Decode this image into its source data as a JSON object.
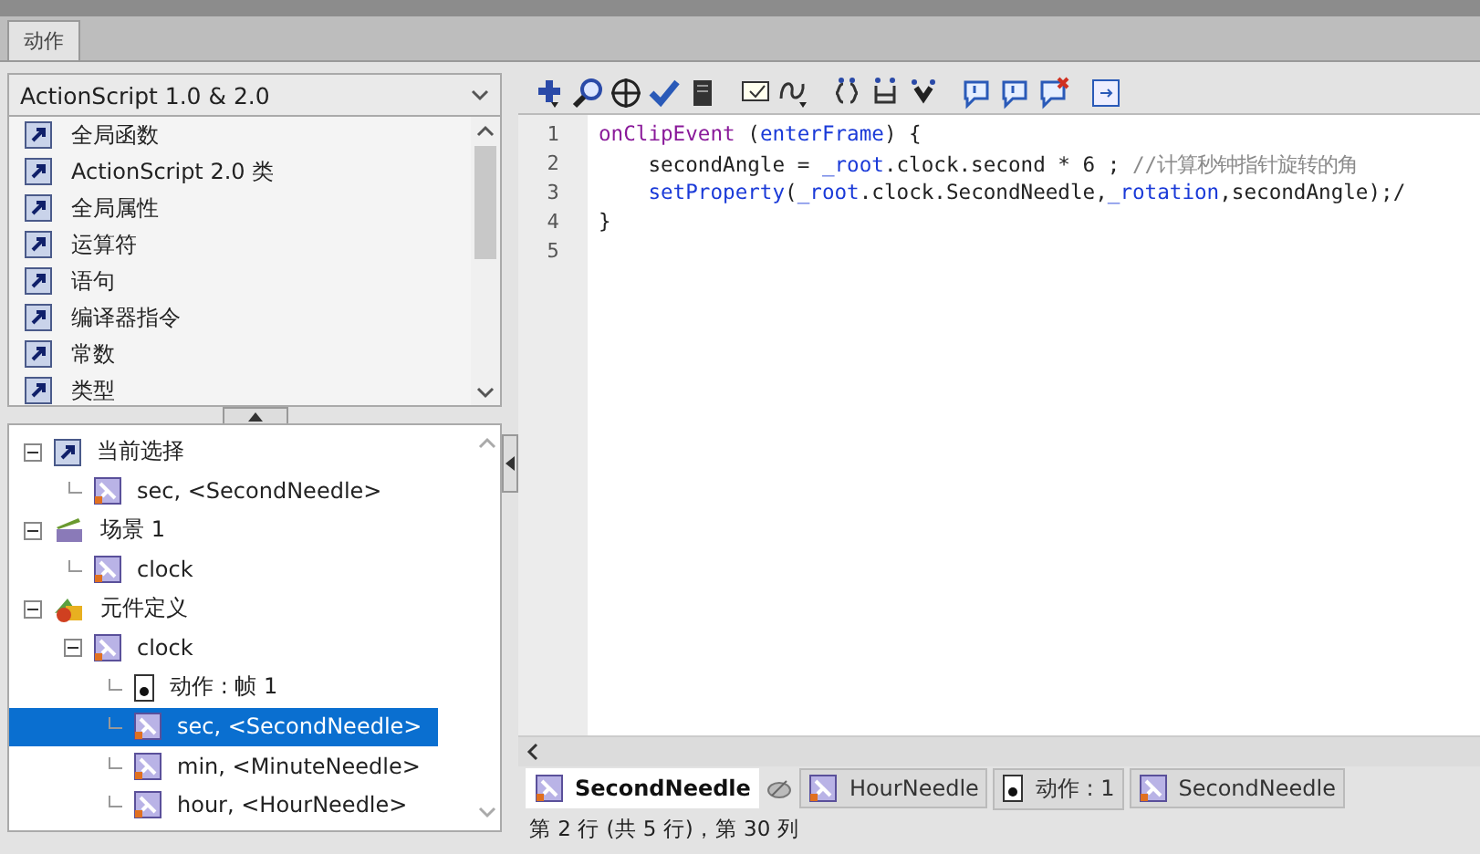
{
  "panel_tab": {
    "label": "动作",
    "selected": true
  },
  "version_dropdown": {
    "value": "ActionScript 1.0 & 2.0"
  },
  "categories": [
    {
      "label": "全局函数"
    },
    {
      "label": "ActionScript 2.0 类"
    },
    {
      "label": "全局属性"
    },
    {
      "label": "运算符"
    },
    {
      "label": "语句"
    },
    {
      "label": "编译器指令"
    },
    {
      "label": "常数"
    },
    {
      "label": "类型"
    }
  ],
  "tree": [
    {
      "label": "当前选择",
      "kind": "book",
      "expanded": true,
      "selected": false,
      "children": [
        {
          "label": "sec, <SecondNeedle>",
          "kind": "clip",
          "selected": false
        }
      ]
    },
    {
      "label": "场景 1",
      "kind": "scene",
      "expanded": true,
      "selected": false,
      "children": [
        {
          "label": "clock",
          "kind": "clip",
          "selected": false
        }
      ]
    },
    {
      "label": "元件定义",
      "kind": "library",
      "expanded": true,
      "selected": false,
      "children": [
        {
          "label": "clock",
          "kind": "clip",
          "expanded": true,
          "selected": false,
          "children": [
            {
              "label": "动作 : 帧 1",
              "kind": "frame",
              "selected": false
            },
            {
              "label": "sec, <SecondNeedle>",
              "kind": "clip",
              "selected": true
            },
            {
              "label": "min, <MinuteNeedle>",
              "kind": "clip",
              "selected": false
            },
            {
              "label": "hour, <HourNeedle>",
              "kind": "clip",
              "selected": false
            }
          ]
        }
      ]
    }
  ],
  "code_lines": [
    {
      "number": "1",
      "tokens": [
        {
          "text": "onClipEvent",
          "kind": "event"
        },
        {
          "text": " (",
          "kind": "plain"
        },
        {
          "text": "enterFrame",
          "kind": "keyword"
        },
        {
          "text": ") {",
          "kind": "plain"
        }
      ]
    },
    {
      "number": "2",
      "tokens": [
        {
          "text": "    secondAngle = ",
          "kind": "plain"
        },
        {
          "text": "_root",
          "kind": "keyword"
        },
        {
          "text": ".clock.second * 6 ; ",
          "kind": "plain"
        },
        {
          "text": "//计算秒钟指针旋转的角",
          "kind": "comment"
        }
      ]
    },
    {
      "number": "3",
      "tokens": [
        {
          "text": "    setProperty",
          "kind": "keyword"
        },
        {
          "text": "(",
          "kind": "plain"
        },
        {
          "text": "_root",
          "kind": "keyword"
        },
        {
          "text": ".clock.SecondNeedle,",
          "kind": "plain"
        },
        {
          "text": "_rotation",
          "kind": "keyword"
        },
        {
          "text": ",secondAngle);/",
          "kind": "plain"
        }
      ]
    },
    {
      "number": "4",
      "tokens": [
        {
          "text": "}",
          "kind": "plain"
        }
      ]
    },
    {
      "number": "5"
    }
  ],
  "script_tabs": [
    {
      "label": "SecondNeedle",
      "kind": "clip",
      "selected": true
    },
    {
      "label": "HourNeedle",
      "kind": "clip",
      "selected": false
    },
    {
      "label": "动作 : 1",
      "kind": "frame",
      "selected": false
    },
    {
      "label": "SecondNeedle",
      "kind": "clip",
      "selected": false
    }
  ],
  "status_bar": {
    "text": "第 2 行 (共 5 行)，第 30 列"
  }
}
